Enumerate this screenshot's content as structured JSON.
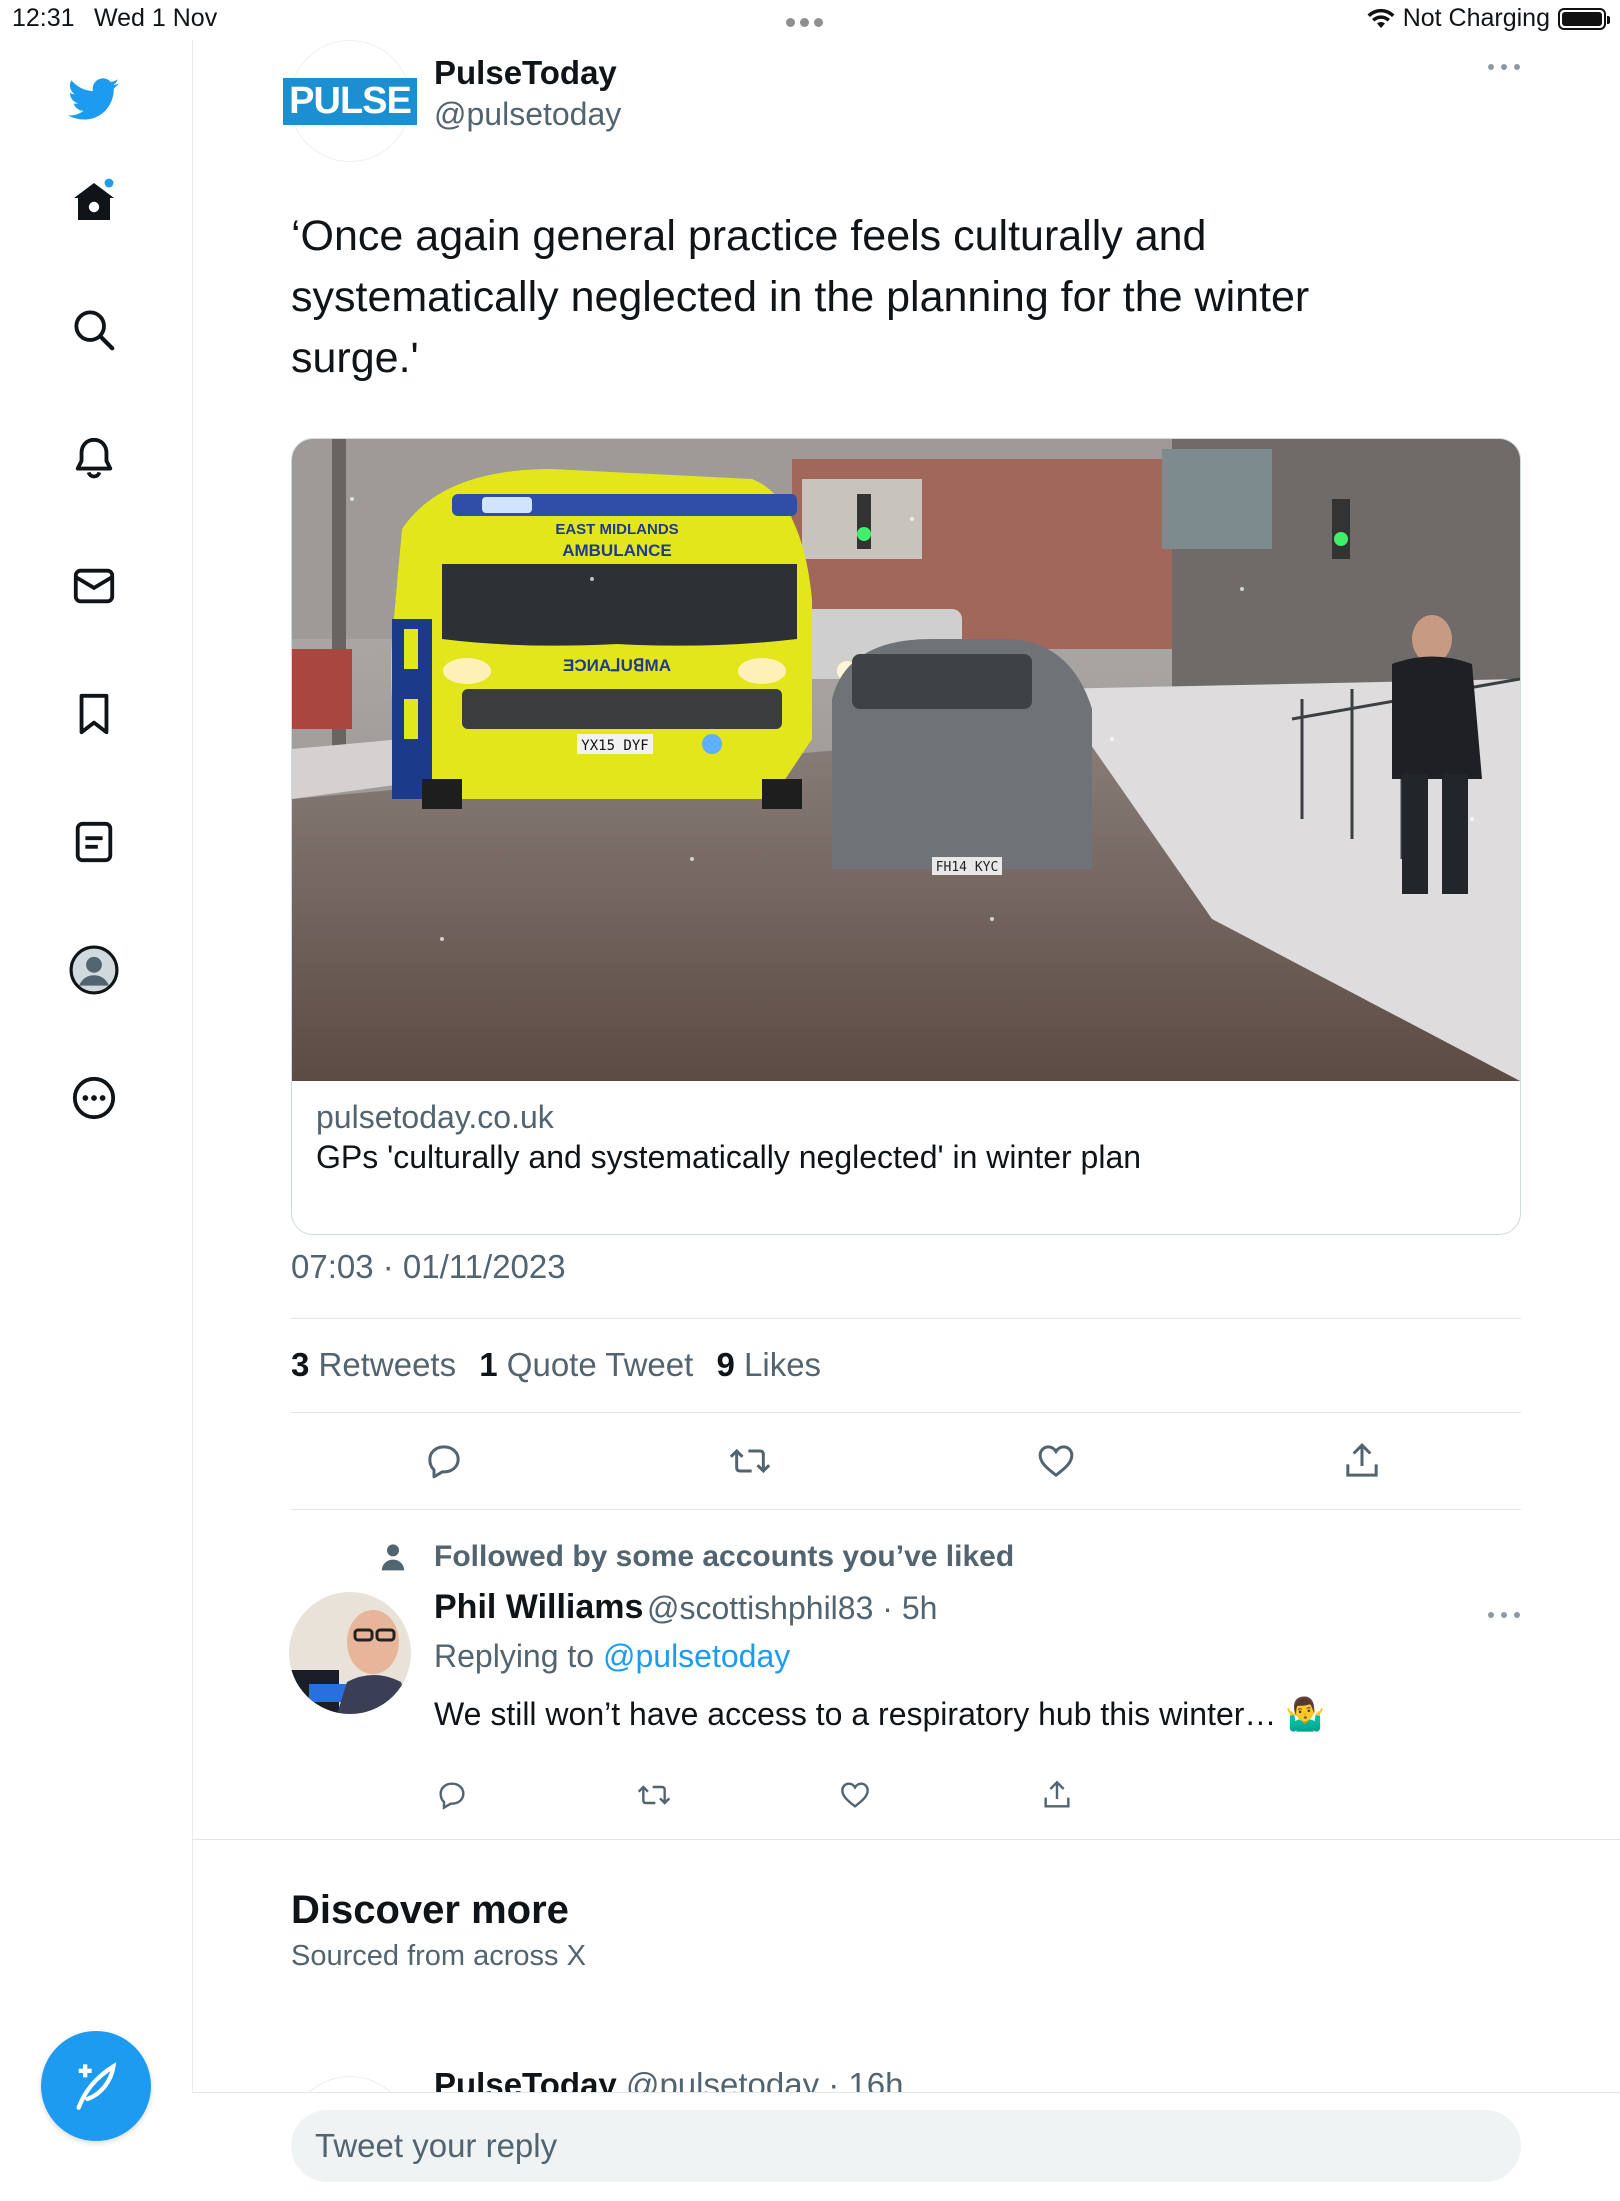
{
  "status_bar": {
    "time": "12:31",
    "date": "Wed 1 Nov",
    "battery_status": "Not Charging"
  },
  "sidebar": {
    "items": [
      {
        "name": "twitter-logo",
        "icon": "bird"
      },
      {
        "name": "home",
        "icon": "home"
      },
      {
        "name": "explore",
        "icon": "search"
      },
      {
        "name": "notifications",
        "icon": "bell"
      },
      {
        "name": "messages",
        "icon": "mail"
      },
      {
        "name": "bookmarks",
        "icon": "bookmark"
      },
      {
        "name": "lists",
        "icon": "list"
      },
      {
        "name": "profile",
        "icon": "avatar"
      },
      {
        "name": "more",
        "icon": "ellipsis-circle"
      }
    ],
    "compose_icon": "feather-plus"
  },
  "tweet": {
    "author_name": "PulseToday",
    "author_handle": "@pulsetoday",
    "logo_text": "PULSE",
    "text": "‘Once again general practice feels culturally and systematically neglected in the planning for the winter surge.'",
    "card": {
      "domain": "pulsetoday.co.uk",
      "title": "GPs 'culturally and systematically neglected' in winter plan",
      "image_text": {
        "ambulance_top": "EAST MIDLANDS",
        "ambulance_label": "AMBULANCE",
        "ambulance_mirror": "ƎƆИA⅃UꓭMA",
        "plate": "YX15 DYF",
        "car_plate": "FH14 KYC"
      }
    },
    "timestamp": "07:03 · 01/11/2023",
    "stats": {
      "retweets_count": "3",
      "retweets_label": "Retweets",
      "quotes_count": "1",
      "quotes_label": "Quote Tweet",
      "likes_count": "9",
      "likes_label": "Likes"
    }
  },
  "reply": {
    "social_context": "Followed by some accounts you’ve liked",
    "name": "Phil Williams",
    "handle_time": "@scottishphil83 · 5h",
    "replying_prefix": "Replying to ",
    "replying_handle": "@pulsetoday",
    "text": "We still won’t have access to a respiratory hub this winter… 🤷‍♂️"
  },
  "discover": {
    "title": "Discover more",
    "subtitle": "Sourced from across X",
    "peek_name": "PulseToday",
    "peek_handle_time": "@pulsetoday · 16h"
  },
  "reply_bar": {
    "placeholder": "Tweet your reply"
  },
  "colors": {
    "accent": "#1d9bf0",
    "secondary_text": "#536471",
    "primary_text": "#0f1419"
  }
}
